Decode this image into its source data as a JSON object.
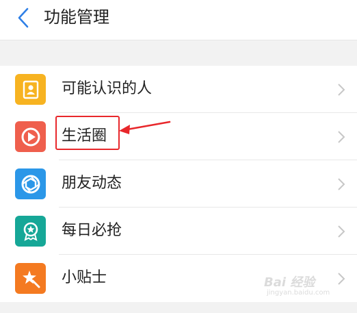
{
  "header": {
    "title": "功能管理",
    "back_icon": "back-arrow-icon"
  },
  "items": [
    {
      "label": "可能认识的人",
      "icon": "contacts-icon",
      "color": "#f7b321"
    },
    {
      "label": "生活圈",
      "icon": "play-circle-icon",
      "color": "#ef5f4d"
    },
    {
      "label": "朋友动态",
      "icon": "aperture-icon",
      "color": "#2b97e8"
    },
    {
      "label": "每日必抢",
      "icon": "badge-star-icon",
      "color": "#16a797"
    },
    {
      "label": "小贴士",
      "icon": "magic-star-icon",
      "color": "#f47a21"
    }
  ],
  "annotation": {
    "highlight_color": "#e8272b",
    "highlighted_item": "生活圈"
  },
  "watermark": {
    "text": "Bai 经验",
    "sub": "jingyan.baidu.com"
  }
}
